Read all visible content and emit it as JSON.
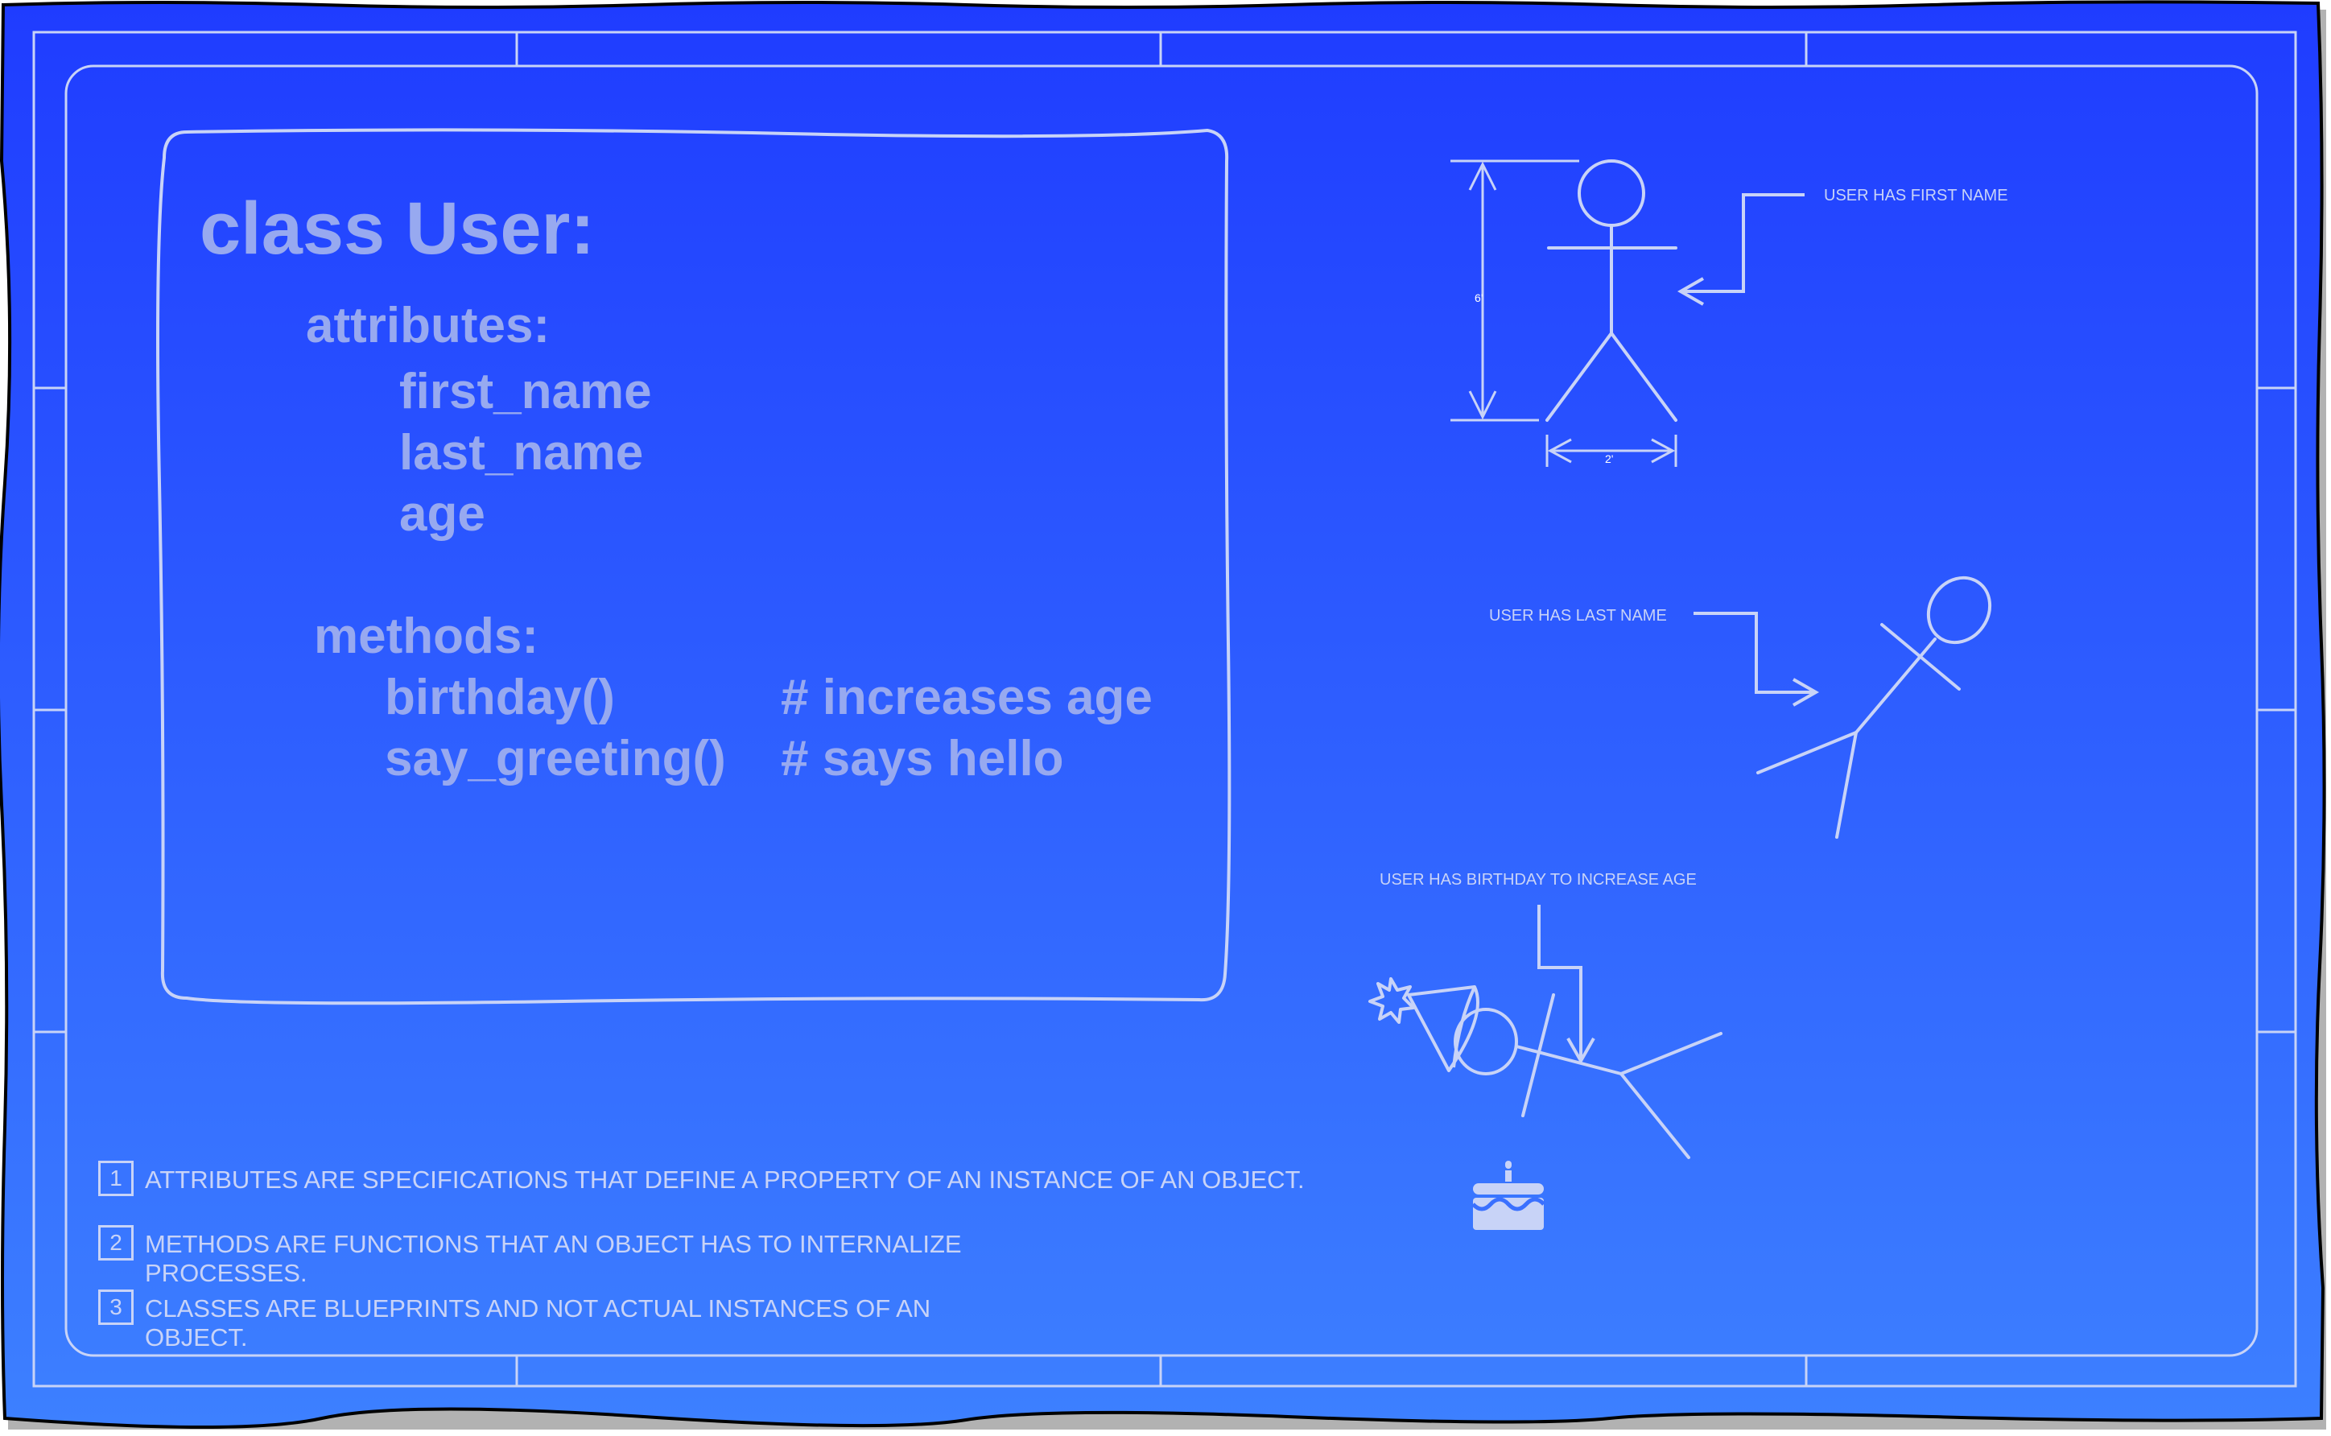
{
  "colors": {
    "paper_top": "#1f3cff",
    "paper_bottom": "#3d80ff",
    "line": "#c8d3f7",
    "code_text": "#97a9f0"
  },
  "code": {
    "title": "class User:",
    "attributes_header": "attributes:",
    "attributes": [
      "first_name",
      "last_name",
      "age"
    ],
    "methods_header": "methods:",
    "methods": [
      {
        "name": "birthday()",
        "comment": "# increases age"
      },
      {
        "name": "say_greeting()",
        "comment": "# says hello"
      }
    ]
  },
  "notes": [
    {
      "number": "1",
      "text": "ATTRIBUTES ARE SPECIFICATIONS THAT DEFINE A PROPERTY OF AN INSTANCE OF AN OBJECT."
    },
    {
      "number": "2",
      "text": "METHODS ARE FUNCTIONS THAT AN OBJECT HAS TO INTERNALIZE PROCESSES."
    },
    {
      "number": "3",
      "text": "CLASSES ARE BLUEPRINTS AND NOT ACTUAL INSTANCES OF AN OBJECT."
    }
  ],
  "figures": {
    "first_name_label": "USER HAS FIRST NAME",
    "last_name_label": "USER HAS LAST NAME",
    "birthday_label": "USER HAS BIRTHDAY TO INCREASE AGE",
    "height_dimension": "6'",
    "width_dimension": "2'"
  },
  "icons": {
    "party_hat": "party-hat-icon",
    "cake": "cake-icon"
  }
}
